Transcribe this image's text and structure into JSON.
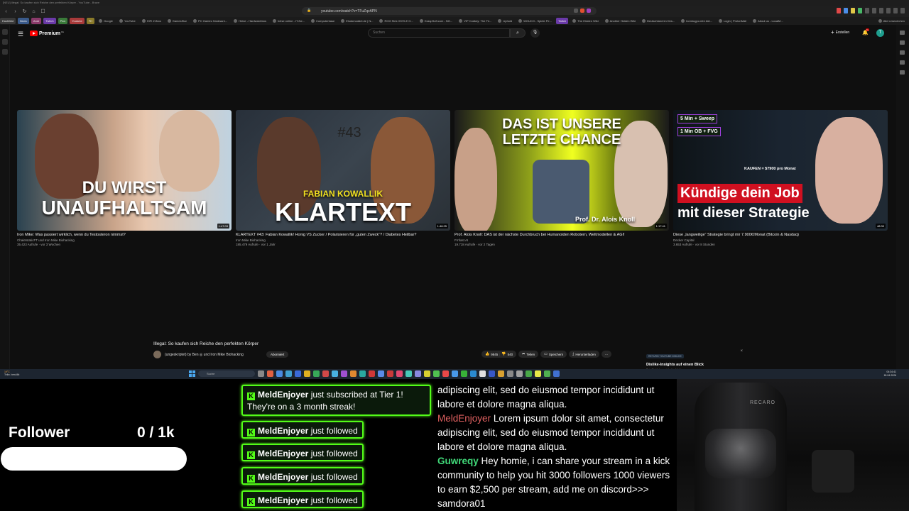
{
  "browser": {
    "window_title": "[NEU] Illegal: So kaufen sich Reiche den perfekten Körper - YouTube - Brave",
    "url": "youtube.com/watch?v=TFuZqvAPN",
    "bookmarks": [
      "Hochfeld",
      "News",
      "Andr",
      "Twitch",
      "Pics",
      "Youtube",
      "FH",
      "Google",
      "YouTube",
      "HIFI Z.Bios",
      "GamesStar",
      "PC Games Hardware...",
      "Heise - Hardwarefans",
      "heise online - IT-Ne...",
      "Computerbase",
      "Elsdomoddel.de | N...",
      "ROG Strix X570-E G...",
      "GraspSoft.com - NG...",
      "VIP Codkey: The Fri...",
      "Uphold",
      "WOUCO - Spiele Pe...",
      "Twitch",
      "The Hidden Wiki",
      "Another Hidden Wiki",
      "Deutschland im Des...",
      "bcmbugpo.mbr Akt...",
      "Login | ProtonMail",
      "About us - LocalM...",
      "Alle Lesezeichen"
    ]
  },
  "youtube": {
    "brand": "Premium",
    "brand_sup": "DE",
    "search_placeholder": "Suchen",
    "create_label": "Erstellen",
    "notif_count": "9+",
    "avatar_letter": "T"
  },
  "videos": [
    {
      "thumb_text_1": "DU WIRST",
      "thumb_text_2": "UNAUFHALTSAM",
      "duration": "1:47:03",
      "title": "Iron Mike: Was passiert wirklich, wenn du Testosteron nimmst?",
      "channel": "ChaletstaticFT und Iron Mike Biohacking",
      "meta": "35.423 Aufrufe · vor 3 Wochen"
    },
    {
      "thumb_text_1": "#43",
      "thumb_text_2": "FABIAN KOWALLIK",
      "thumb_text_3": "KLARTEXT",
      "duration": "1:46:25",
      "title": "KLARTEXT #43: Fabian Kowallik! Honig VS Zucker / Polarisieren für „guten Zweck“? / Diabetes Heilbar?",
      "channel": "Iron Mike Biohacking",
      "meta": "185.479 Aufrufe · vor 1 Jahr"
    },
    {
      "thumb_text_1": "DAS IST UNSERE",
      "thumb_text_2": "LETZTE CHANCE",
      "thumb_text_3": "Prof. Dr. Alois Knoll",
      "duration": "1:17:41",
      "title": "Prof. Alois Knoll: DAS ist der nächste Durchbruch bei Humanoiden Robotern, Weltmodellen & AGI!",
      "channel": "Frnfast AI",
      "meta": "19.718 Aufrufe · vor 2 Tagen"
    },
    {
      "thumb_text_1": "5 Min + Sweep",
      "thumb_text_2": "1 Min OB + FVG",
      "thumb_text_3": "KAUFEN = $7900 pro Monat",
      "thumb_text_4": "Kündige dein Job",
      "thumb_text_5": "mit dieser Strategie",
      "duration": "48:30",
      "title": "Diese „langweilige“ Strategie bringt mir 7.900€/Monat (Bitcoin & Nasdaq)",
      "channel": "Decker Capital",
      "meta": "3.653 Aufrufe · vor 8 Stunden"
    }
  ],
  "player": {
    "title": "Illegal: So kaufen sich Reiche den perfekten Körper",
    "channel": "(ungeskriptet) by Ben ◎ und Iron Mike Biohacking",
    "subscribe": "Abonniert",
    "likes": "9845",
    "dislikes": "540",
    "share": "Teilen",
    "save": "Speichern",
    "download": "Herunterladen",
    "more": "···",
    "rd_tag": "RETURN YOUTUBE DISLIKE",
    "rd_title": "Dislike-Insights auf einen Blick",
    "rd_desc": "Roh-Einblicke und direkte Meldungen von"
  },
  "taskbar": {
    "weather_temp": "19°C",
    "weather_desc": "Teilw. bewölkt",
    "search": "Suche",
    "time": "04:34:41",
    "date": "18.04.2026"
  },
  "overlay": {
    "follower_label": "Follower",
    "follower_count": "0 / 1k",
    "follower_progress": 0,
    "alerts": [
      {
        "user": "MeldEnjoyer",
        "text": " just subscribed at Tier 1! They're on a 3 month streak!"
      },
      {
        "user": "MeldEnjoyer",
        "text": " just followed"
      },
      {
        "user": "MeldEnjoyer",
        "text": " just followed"
      },
      {
        "user": "MeldEnjoyer",
        "text": " just followed"
      },
      {
        "user": "MeldEnjoyer",
        "text": " just followed"
      }
    ],
    "chat": [
      {
        "user": "",
        "text": "adipiscing elit, sed do eiusmod tempor incididunt ut labore et dolore magna aliqua."
      },
      {
        "user": "MeldEnjoyer",
        "text": "Lorem ipsum dolor sit amet, consectetur adipiscing elit, sed do eiusmod tempor incididunt ut labore et dolore magna aliqua."
      },
      {
        "user": "Guwreqy",
        "text": "Hey homie, i can share your stream in a kick community to help you hit 3000 followers 1000 viewers to earn $2,500 per stream, add me on discord>>> samdora01"
      }
    ],
    "chair_brand": "RECARO"
  },
  "colors": {
    "kick_green": "#53fc18",
    "yt_red": "#ff0000",
    "chat_user_red": "#e06060",
    "chat_user_green": "#40d878"
  }
}
